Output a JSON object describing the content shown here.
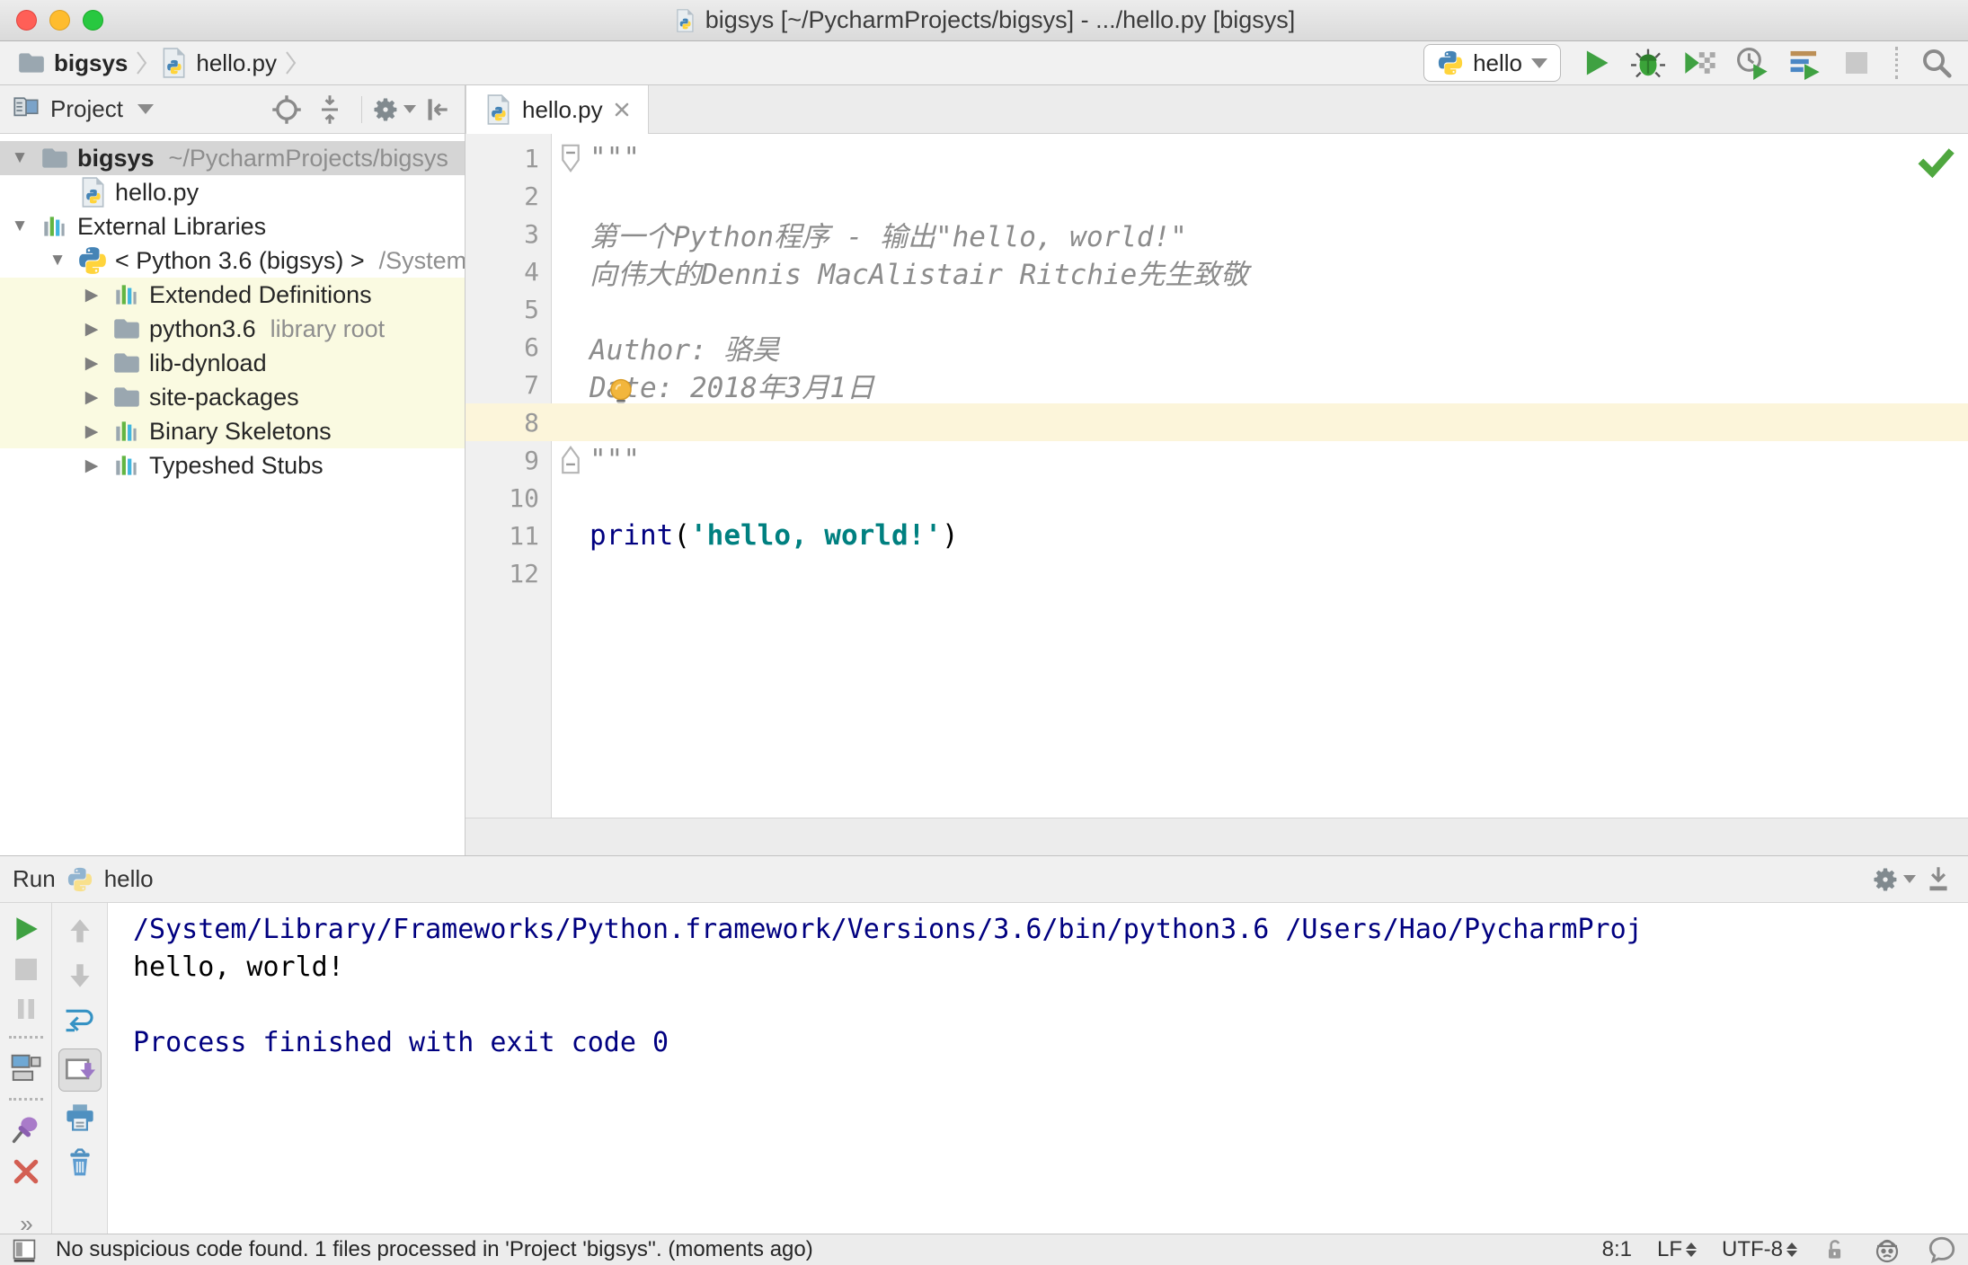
{
  "title_bar": {
    "title": "bigsys [~/PycharmProjects/bigsys] - .../hello.py [bigsys]"
  },
  "toolbar": {
    "breadcrumbs": [
      {
        "label": "bigsys",
        "icon": "folder"
      },
      {
        "label": "hello.py",
        "icon": "python-file"
      }
    ],
    "run_config": {
      "label": "hello"
    }
  },
  "project_panel": {
    "header": {
      "title": "Project"
    },
    "tree": [
      {
        "label": "bigsys",
        "hint": "~/PycharmProjects/bigsys",
        "icon": "folder",
        "level": 1,
        "arrow": "expanded",
        "bold": true,
        "bg": "selected"
      },
      {
        "label": "hello.py",
        "hint": "",
        "icon": "python-file",
        "level": 2,
        "arrow": "none",
        "bold": false,
        "bg": "none"
      },
      {
        "label": "External Libraries",
        "hint": "",
        "icon": "library",
        "level": 1,
        "arrow": "expanded",
        "bold": false,
        "bg": "none"
      },
      {
        "label": "< Python 3.6 (bigsys) >",
        "hint": "/System",
        "icon": "python",
        "level": 2,
        "arrow": "expanded",
        "bold": false,
        "bg": "none"
      },
      {
        "label": "Extended Definitions",
        "hint": "",
        "icon": "library",
        "level": 3,
        "arrow": "collapsed",
        "bold": false,
        "bg": "yellow"
      },
      {
        "label": "python3.6",
        "hint": "library root",
        "icon": "folder",
        "level": 3,
        "arrow": "collapsed",
        "bold": false,
        "bg": "yellow"
      },
      {
        "label": "lib-dynload",
        "hint": "",
        "icon": "folder",
        "level": 3,
        "arrow": "collapsed",
        "bold": false,
        "bg": "yellow"
      },
      {
        "label": "site-packages",
        "hint": "",
        "icon": "folder",
        "level": 3,
        "arrow": "collapsed",
        "bold": false,
        "bg": "yellow"
      },
      {
        "label": "Binary Skeletons",
        "hint": "",
        "icon": "library",
        "level": 3,
        "arrow": "collapsed",
        "bold": false,
        "bg": "yellow"
      },
      {
        "label": "Typeshed Stubs",
        "hint": "",
        "icon": "library",
        "level": 3,
        "arrow": "collapsed",
        "bold": false,
        "bg": "none"
      }
    ]
  },
  "editor": {
    "tab": {
      "label": "hello.py"
    },
    "lines": [
      {
        "num": "1",
        "fold": "top",
        "caret": false,
        "bulb": false,
        "segments": [
          {
            "t": "\"\"\"",
            "c": "docstring"
          }
        ]
      },
      {
        "num": "2",
        "fold": "none",
        "caret": false,
        "bulb": false,
        "segments": []
      },
      {
        "num": "3",
        "fold": "none",
        "caret": false,
        "bulb": false,
        "segments": [
          {
            "t": "第一个Python程序 - 输出\"hello, world!\"",
            "c": "docstring"
          }
        ]
      },
      {
        "num": "4",
        "fold": "none",
        "caret": false,
        "bulb": false,
        "segments": [
          {
            "t": "向伟大的Dennis MacAlistair Ritchie先生致敬",
            "c": "docstring"
          }
        ]
      },
      {
        "num": "5",
        "fold": "none",
        "caret": false,
        "bulb": false,
        "segments": []
      },
      {
        "num": "6",
        "fold": "none",
        "caret": false,
        "bulb": false,
        "segments": [
          {
            "t": "Author: 骆昊",
            "c": "docstring"
          }
        ]
      },
      {
        "num": "7",
        "fold": "none",
        "caret": false,
        "bulb": true,
        "segments": [
          {
            "t": "Date: 2018年3月1日",
            "c": "docstring"
          }
        ]
      },
      {
        "num": "8",
        "fold": "none",
        "caret": true,
        "bulb": false,
        "segments": []
      },
      {
        "num": "9",
        "fold": "bottom",
        "caret": false,
        "bulb": false,
        "segments": [
          {
            "t": "\"\"\"",
            "c": "docstring"
          }
        ]
      },
      {
        "num": "10",
        "fold": "none",
        "caret": false,
        "bulb": false,
        "segments": []
      },
      {
        "num": "11",
        "fold": "none",
        "caret": false,
        "bulb": false,
        "segments": [
          {
            "t": "print",
            "c": "keyword"
          },
          {
            "t": "(",
            "c": "plain"
          },
          {
            "t": "'hello, world!'",
            "c": "string"
          },
          {
            "t": ")",
            "c": "plain"
          }
        ]
      },
      {
        "num": "12",
        "fold": "none",
        "caret": false,
        "bulb": false,
        "segments": []
      }
    ]
  },
  "run_panel": {
    "header": {
      "label": "Run",
      "config": "hello"
    },
    "console": [
      {
        "text": "/System/Library/Frameworks/Python.framework/Versions/3.6/bin/python3.6 /Users/Hao/PycharmProj",
        "color": "system"
      },
      {
        "text": "hello, world!",
        "color": "stdout"
      },
      {
        "text": "",
        "color": "stdout"
      },
      {
        "text": "Process finished with exit code 0",
        "color": "system"
      }
    ]
  },
  "status_bar": {
    "message": "No suspicious code found. 1 files processed in 'Project 'bigsys''. (moments ago)",
    "position": "8:1",
    "line_ending": "LF",
    "encoding": "UTF-8"
  },
  "colors": {
    "run_green": "#3fa142",
    "caret_line": "#fcf5da",
    "library_row_yellow": "#fafae1",
    "selected_row_gray": "#d5d5d5",
    "keyword_navy": "#000080",
    "string_teal": "#008080",
    "docstring_gray": "#8c8c8c",
    "console_system_navy": "#000080"
  }
}
